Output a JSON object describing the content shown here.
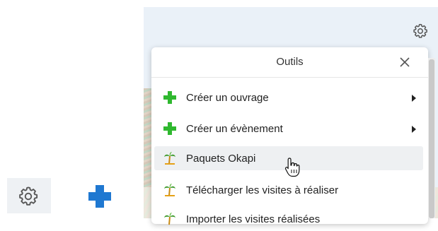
{
  "toolbar": {
    "settings_icon": "gear-icon"
  },
  "tools_menu": {
    "title": "Outils",
    "close_icon": "close-icon",
    "items": [
      {
        "label": "Créer un ouvrage",
        "icon": "green-plus-icon",
        "has_submenu": true
      },
      {
        "label": "Créer un évènement",
        "icon": "green-plus-icon",
        "has_submenu": true
      },
      {
        "label": "Paquets Okapi",
        "icon": "palm-tree-icon",
        "has_submenu": false,
        "hovered": true
      },
      {
        "label": "Télécharger les visites à réaliser",
        "icon": "palm-tree-icon",
        "has_submenu": false
      },
      {
        "label": "Importer les visites réalisées",
        "icon": "palm-tree-icon",
        "has_submenu": false
      }
    ]
  },
  "colors": {
    "plus_green": "#2fb82f",
    "plus_blue": "#1f78d1",
    "palm_orange": "#e6a117",
    "palm_green": "#3d9a2a"
  },
  "standalone": {
    "gear_icon": "gear-icon",
    "plus_icon": "blue-plus-icon"
  }
}
